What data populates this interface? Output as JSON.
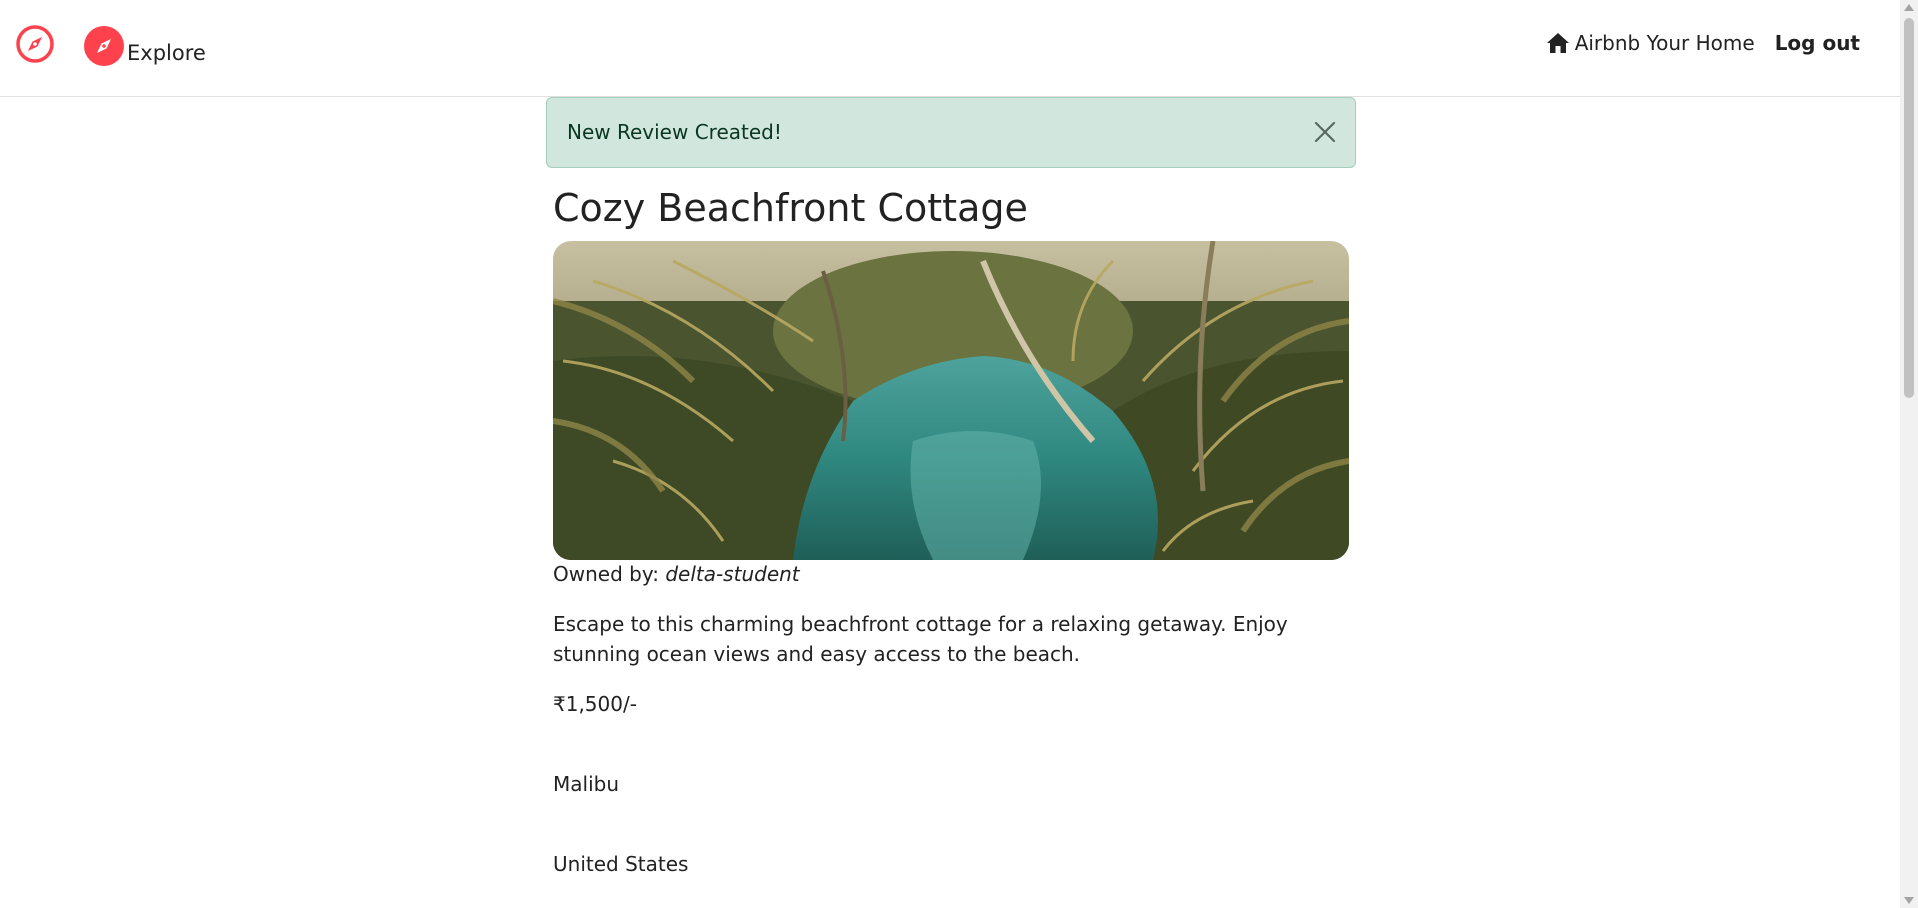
{
  "nav": {
    "explore_label": "Explore",
    "host_label": "Airbnb Your Home",
    "logout_label": "Log out",
    "brand_color": "#fe424d",
    "icons": {
      "brand": "compass-icon",
      "host": "house-icon"
    }
  },
  "alert": {
    "message": "New Review Created!",
    "close_icon": "close-icon",
    "background": "#d1e7dd"
  },
  "listing": {
    "title": "Cozy Beachfront Cottage",
    "owner_prefix": "Owned by: ",
    "owner_name": "delta-student",
    "description": "Escape to this charming beachfront cottage for a relaxing getaway. Enjoy stunning ocean views and easy access to the beach.",
    "price": "₹1,500/-",
    "location": "Malibu",
    "country": "United States"
  }
}
